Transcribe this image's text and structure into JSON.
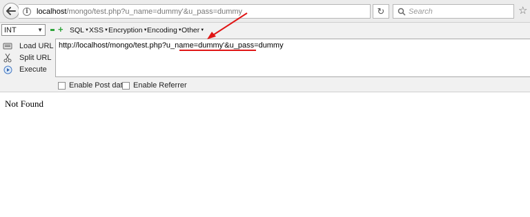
{
  "browser": {
    "url": {
      "host": "localhost",
      "path": "/mongo/test.php?u_name=dummy'&u_pass=dummy"
    },
    "search_placeholder": "Search"
  },
  "hackbar": {
    "select_value": "INT",
    "menus": [
      "SQL",
      "XSS",
      "Encryption",
      "Encoding",
      "Other"
    ],
    "actions": {
      "load_url": "Load URL",
      "split_url": "Split URL",
      "execute": "Execute"
    },
    "url_value": "http://localhost/mongo/test.php?u_name=dummy'&u_pass=dummy",
    "checkboxes": {
      "post_data": "Enable Post data",
      "referrer": "Enable Referrer"
    }
  },
  "page": {
    "message": "Not Found"
  },
  "colors": {
    "annotation": "#e01515",
    "hackbar_green": "#2ea43a"
  }
}
